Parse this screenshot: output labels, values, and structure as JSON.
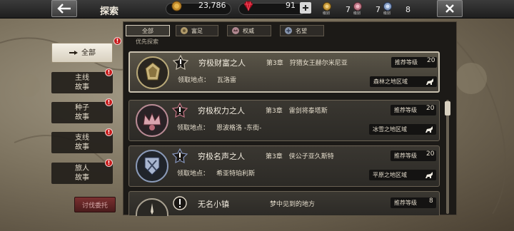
{
  "header": {
    "title": "探索",
    "gold": "23,786",
    "gems": "91",
    "medals": [
      {
        "icon": "gold-medal-icon",
        "sublabel": "级别",
        "count": "7"
      },
      {
        "icon": "pink-medal-icon",
        "sublabel": "级别",
        "count": "7"
      },
      {
        "icon": "blue-medal-icon",
        "sublabel": "级别",
        "count": "8"
      }
    ]
  },
  "sidebar": {
    "items": [
      {
        "label": "全部",
        "active": true,
        "badge": "!"
      },
      {
        "label": "主线\n故事",
        "badge": "!"
      },
      {
        "label": "种子\n故事",
        "badge": "!"
      },
      {
        "label": "支线\n故事",
        "badge": "!"
      },
      {
        "label": "旅人\n故事",
        "badge": "!"
      }
    ],
    "hunt_button": "讨伐委托"
  },
  "filters": {
    "tabs": [
      {
        "label": "全部",
        "icon": ""
      },
      {
        "label": "富足",
        "icon": "wealth-icon"
      },
      {
        "label": "权威",
        "icon": "power-icon"
      },
      {
        "label": "名望",
        "icon": "fame-icon"
      }
    ]
  },
  "section_label": "优先探索",
  "quests": [
    {
      "name": "穷极财富之人",
      "chapter": "第3章　狩猎女王赫尔米尼亚",
      "location_label": "领取地点：",
      "location": "瓦洛雷",
      "reco_label": "推荐等级",
      "level": "20",
      "region": "森林之地区域",
      "emblem": "wealth-emblem-icon"
    },
    {
      "name": "穷极权力之人",
      "chapter": "第3章　雷剑将泰塔斯",
      "location_label": "领取地点：",
      "location": "恩波格洛 -东街-",
      "reco_label": "推荐等级",
      "level": "20",
      "region": "冰雪之地区域",
      "emblem": "power-emblem-icon"
    },
    {
      "name": "穷极名声之人",
      "chapter": "第3章　侠公子亚久斯特",
      "location_label": "领取地点：",
      "location": "希亚特珀利斯",
      "reco_label": "推荐等级",
      "level": "20",
      "region": "平原之地区域",
      "emblem": "fame-emblem-icon"
    },
    {
      "name": "无名小镇",
      "chapter": "梦中见到的地方",
      "reco_label": "推荐等级",
      "level": "8"
    }
  ],
  "colors": {
    "accent_red": "#c81c1c",
    "panel_bg": "#1c1a17",
    "card_border": "#6a6254"
  }
}
